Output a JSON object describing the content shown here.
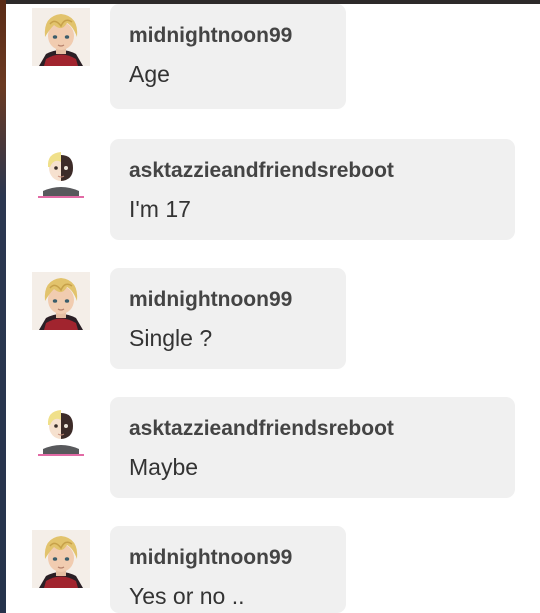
{
  "messages": [
    {
      "author": "midnightnoon99",
      "text": "Age"
    },
    {
      "author": "asktazzieandfriendsreboot",
      "text": "I'm 17"
    },
    {
      "author": "midnightnoon99",
      "text": "Single ?"
    },
    {
      "author": "asktazzieandfriendsreboot",
      "text": "Maybe"
    },
    {
      "author": "midnightnoon99",
      "text": "Yes or no .."
    }
  ],
  "colors": {
    "bubble_bg": "#f0f0f0",
    "author_text": "#444444",
    "message_text": "#333333"
  },
  "icons": {
    "user_a_avatar": "blond-anime-avatar",
    "user_b_avatar": "half-face-avatar"
  }
}
